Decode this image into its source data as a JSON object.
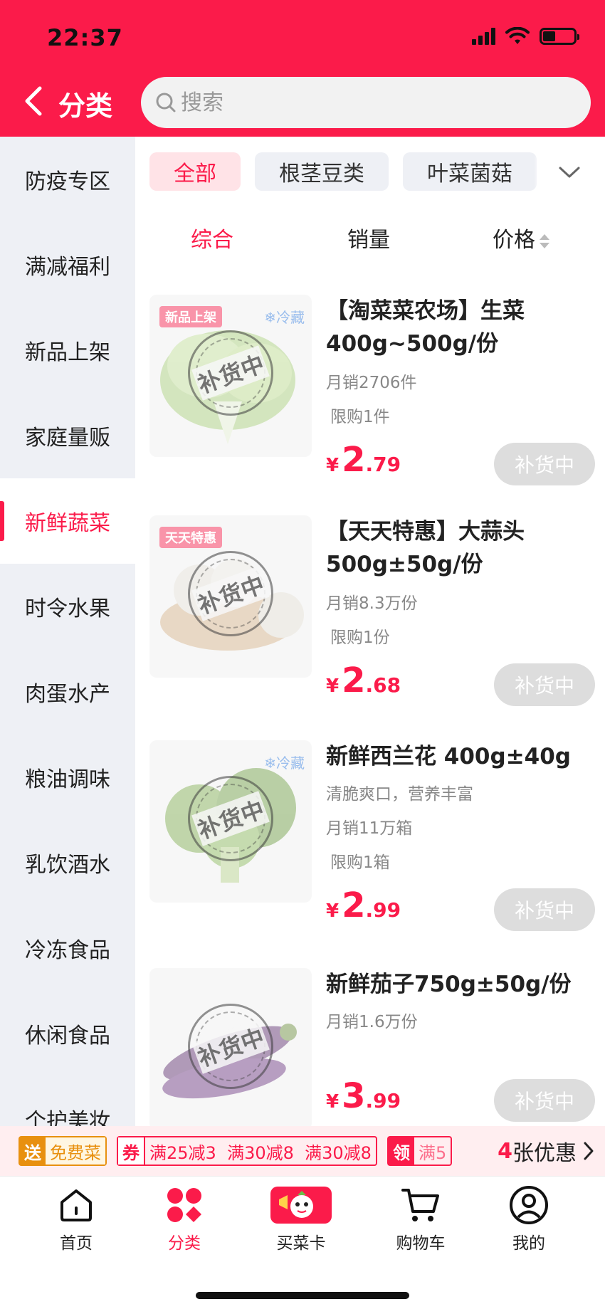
{
  "status_bar": {
    "time": "22:37"
  },
  "nav": {
    "title": "分类",
    "search_placeholder": "搜索"
  },
  "sidebar": {
    "items": [
      {
        "label": "防疫专区"
      },
      {
        "label": "满减福利"
      },
      {
        "label": "新品上架"
      },
      {
        "label": "家庭量贩"
      },
      {
        "label": "新鲜蔬菜",
        "active": true
      },
      {
        "label": "时令水果"
      },
      {
        "label": "肉蛋水产"
      },
      {
        "label": "粮油调味"
      },
      {
        "label": "乳饮酒水"
      },
      {
        "label": "冷冻食品"
      },
      {
        "label": "休闲食品"
      },
      {
        "label": "个护美妆"
      }
    ]
  },
  "chips": {
    "items": [
      {
        "label": "全部",
        "active": true
      },
      {
        "label": "根茎豆类"
      },
      {
        "label": "叶菜菌菇"
      }
    ]
  },
  "sort": {
    "comprehensive": "综合",
    "sales": "销量",
    "price": "价格"
  },
  "products": [
    {
      "title": "【淘菜菜农场】生菜400g~500g/份",
      "tag": "新品上架",
      "storage": "❄冷藏",
      "monthly_sales": "月销2706件",
      "limit": "限购1件",
      "price_currency": "¥",
      "price_int": "2",
      "price_dec": ".79",
      "stamp": "补货中",
      "button": "补货中"
    },
    {
      "title": "【天天特惠】大蒜头500g±50g/份",
      "tag": "天天特惠",
      "monthly_sales": "月销8.3万份",
      "limit": "限购1份",
      "price_currency": "¥",
      "price_int": "2",
      "price_dec": ".68",
      "stamp": "补货中",
      "button": "补货中"
    },
    {
      "title": "新鲜西兰花 400g±40g",
      "storage": "❄冷藏",
      "subtitle": "清脆爽口，营养丰富",
      "monthly_sales": "月销11万箱",
      "limit": "限购1箱",
      "price_currency": "¥",
      "price_int": "2",
      "price_dec": ".99",
      "stamp": "补货中",
      "button": "补货中"
    },
    {
      "title": "新鲜茄子750g±50g/份",
      "monthly_sales": "月销1.6万份",
      "price_currency": "¥",
      "price_int": "3",
      "price_dec": ".99",
      "stamp": "补货中",
      "button": "补货中"
    }
  ],
  "promo": {
    "send_lead": "送",
    "send_text": "免费菜",
    "coupon_lead": "券",
    "coupon_text": "满25减3  满30减8  满30减8",
    "claim_lead": "领",
    "claim_text": "满5",
    "count_num": "4",
    "count_text": "张优惠"
  },
  "tabbar": {
    "home": "首页",
    "category": "分类",
    "card": "买菜卡",
    "cart": "购物车",
    "mine": "我的"
  },
  "colors": {
    "brand": "#fb1b4a",
    "sidebar_bg": "#eef0f5",
    "disabled": "#dddddd"
  }
}
